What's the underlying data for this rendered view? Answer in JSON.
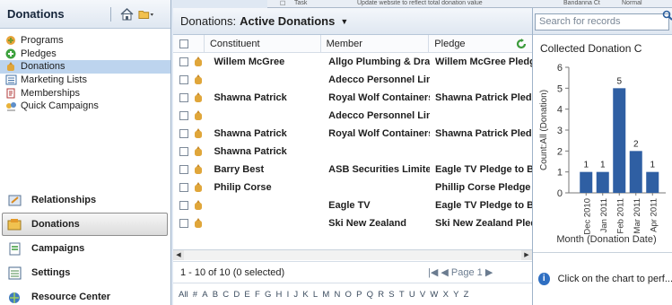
{
  "peek": {
    "task_label": "Task",
    "task_desc": "Update website to reflect total donation value",
    "contact": "Bandanna Ct",
    "priority": "Normal"
  },
  "nav": {
    "title": "Donations",
    "tree": [
      {
        "label": "Programs",
        "icon": "programs-icon"
      },
      {
        "label": "Pledges",
        "icon": "pledges-icon"
      },
      {
        "label": "Donations",
        "icon": "donations-icon",
        "selected": true
      },
      {
        "label": "Marketing Lists",
        "icon": "marketing-lists-icon"
      },
      {
        "label": "Memberships",
        "icon": "memberships-icon"
      },
      {
        "label": "Quick Campaigns",
        "icon": "quick-campaigns-icon"
      }
    ],
    "panes": [
      {
        "label": "Relationships",
        "icon": "relationships-icon"
      },
      {
        "label": "Donations",
        "icon": "donations-icon",
        "selected": true
      },
      {
        "label": "Campaigns",
        "icon": "campaigns-icon"
      },
      {
        "label": "Settings",
        "icon": "settings-icon"
      },
      {
        "label": "Resource Center",
        "icon": "resource-center-icon"
      }
    ]
  },
  "grid": {
    "view_prefix": "Donations:",
    "view_name": "Active Donations",
    "columns": [
      "Constituent",
      "Member",
      "Pledge"
    ],
    "rows": [
      {
        "constituent": "Willem McGree",
        "member": "Allgo Plumbing & Drai",
        "pledge": "Willem McGree Pledge"
      },
      {
        "constituent": "",
        "member": "Adecco Personnel Limit",
        "pledge": ""
      },
      {
        "constituent": "Shawna Patrick",
        "member": "Royal Wolf Containers",
        "pledge": "Shawna Patrick Pledge"
      },
      {
        "constituent": "",
        "member": "Adecco Personnel Limit",
        "pledge": ""
      },
      {
        "constituent": "Shawna Patrick",
        "member": "Royal Wolf Containers",
        "pledge": "Shawna Patrick Pledge"
      },
      {
        "constituent": "Shawna Patrick",
        "member": "",
        "pledge": ""
      },
      {
        "constituent": "Barry Best",
        "member": "ASB Securities Limited",
        "pledge": "Eagle TV Pledge to Bar"
      },
      {
        "constituent": "Philip Corse",
        "member": "",
        "pledge": "Phillip Corse Pledge to"
      },
      {
        "constituent": "",
        "member": "Eagle TV",
        "pledge": "Eagle TV Pledge to Bar"
      },
      {
        "constituent": "",
        "member": "Ski New Zealand",
        "pledge": "Ski New Zealand Pledg"
      }
    ],
    "status": "1 - 10 of 10 (0 selected)",
    "pager": "Page 1",
    "alphabet": [
      "All",
      "#",
      "A",
      "B",
      "C",
      "D",
      "E",
      "F",
      "G",
      "H",
      "I",
      "J",
      "K",
      "L",
      "M",
      "N",
      "O",
      "P",
      "Q",
      "R",
      "S",
      "T",
      "U",
      "V",
      "W",
      "X",
      "Y",
      "Z"
    ]
  },
  "search": {
    "placeholder": "Search for records"
  },
  "chart_pane": {
    "title": "Collected Donation C",
    "footer": "Click on the chart to perf..."
  },
  "chart_data": {
    "type": "bar",
    "title": "Collected Donation C",
    "xlabel": "Month (Donation Date)",
    "ylabel": "Count:All (Donation)",
    "categories": [
      "Dec 2010",
      "Jan 2011",
      "Feb 2011",
      "Mar 2011",
      "Apr 2011"
    ],
    "values": [
      1,
      1,
      5,
      2,
      1
    ],
    "ylim": [
      0,
      6
    ],
    "yticks": [
      0,
      1,
      2,
      3,
      4,
      5,
      6
    ],
    "bar_color": "#2f5fa3"
  }
}
